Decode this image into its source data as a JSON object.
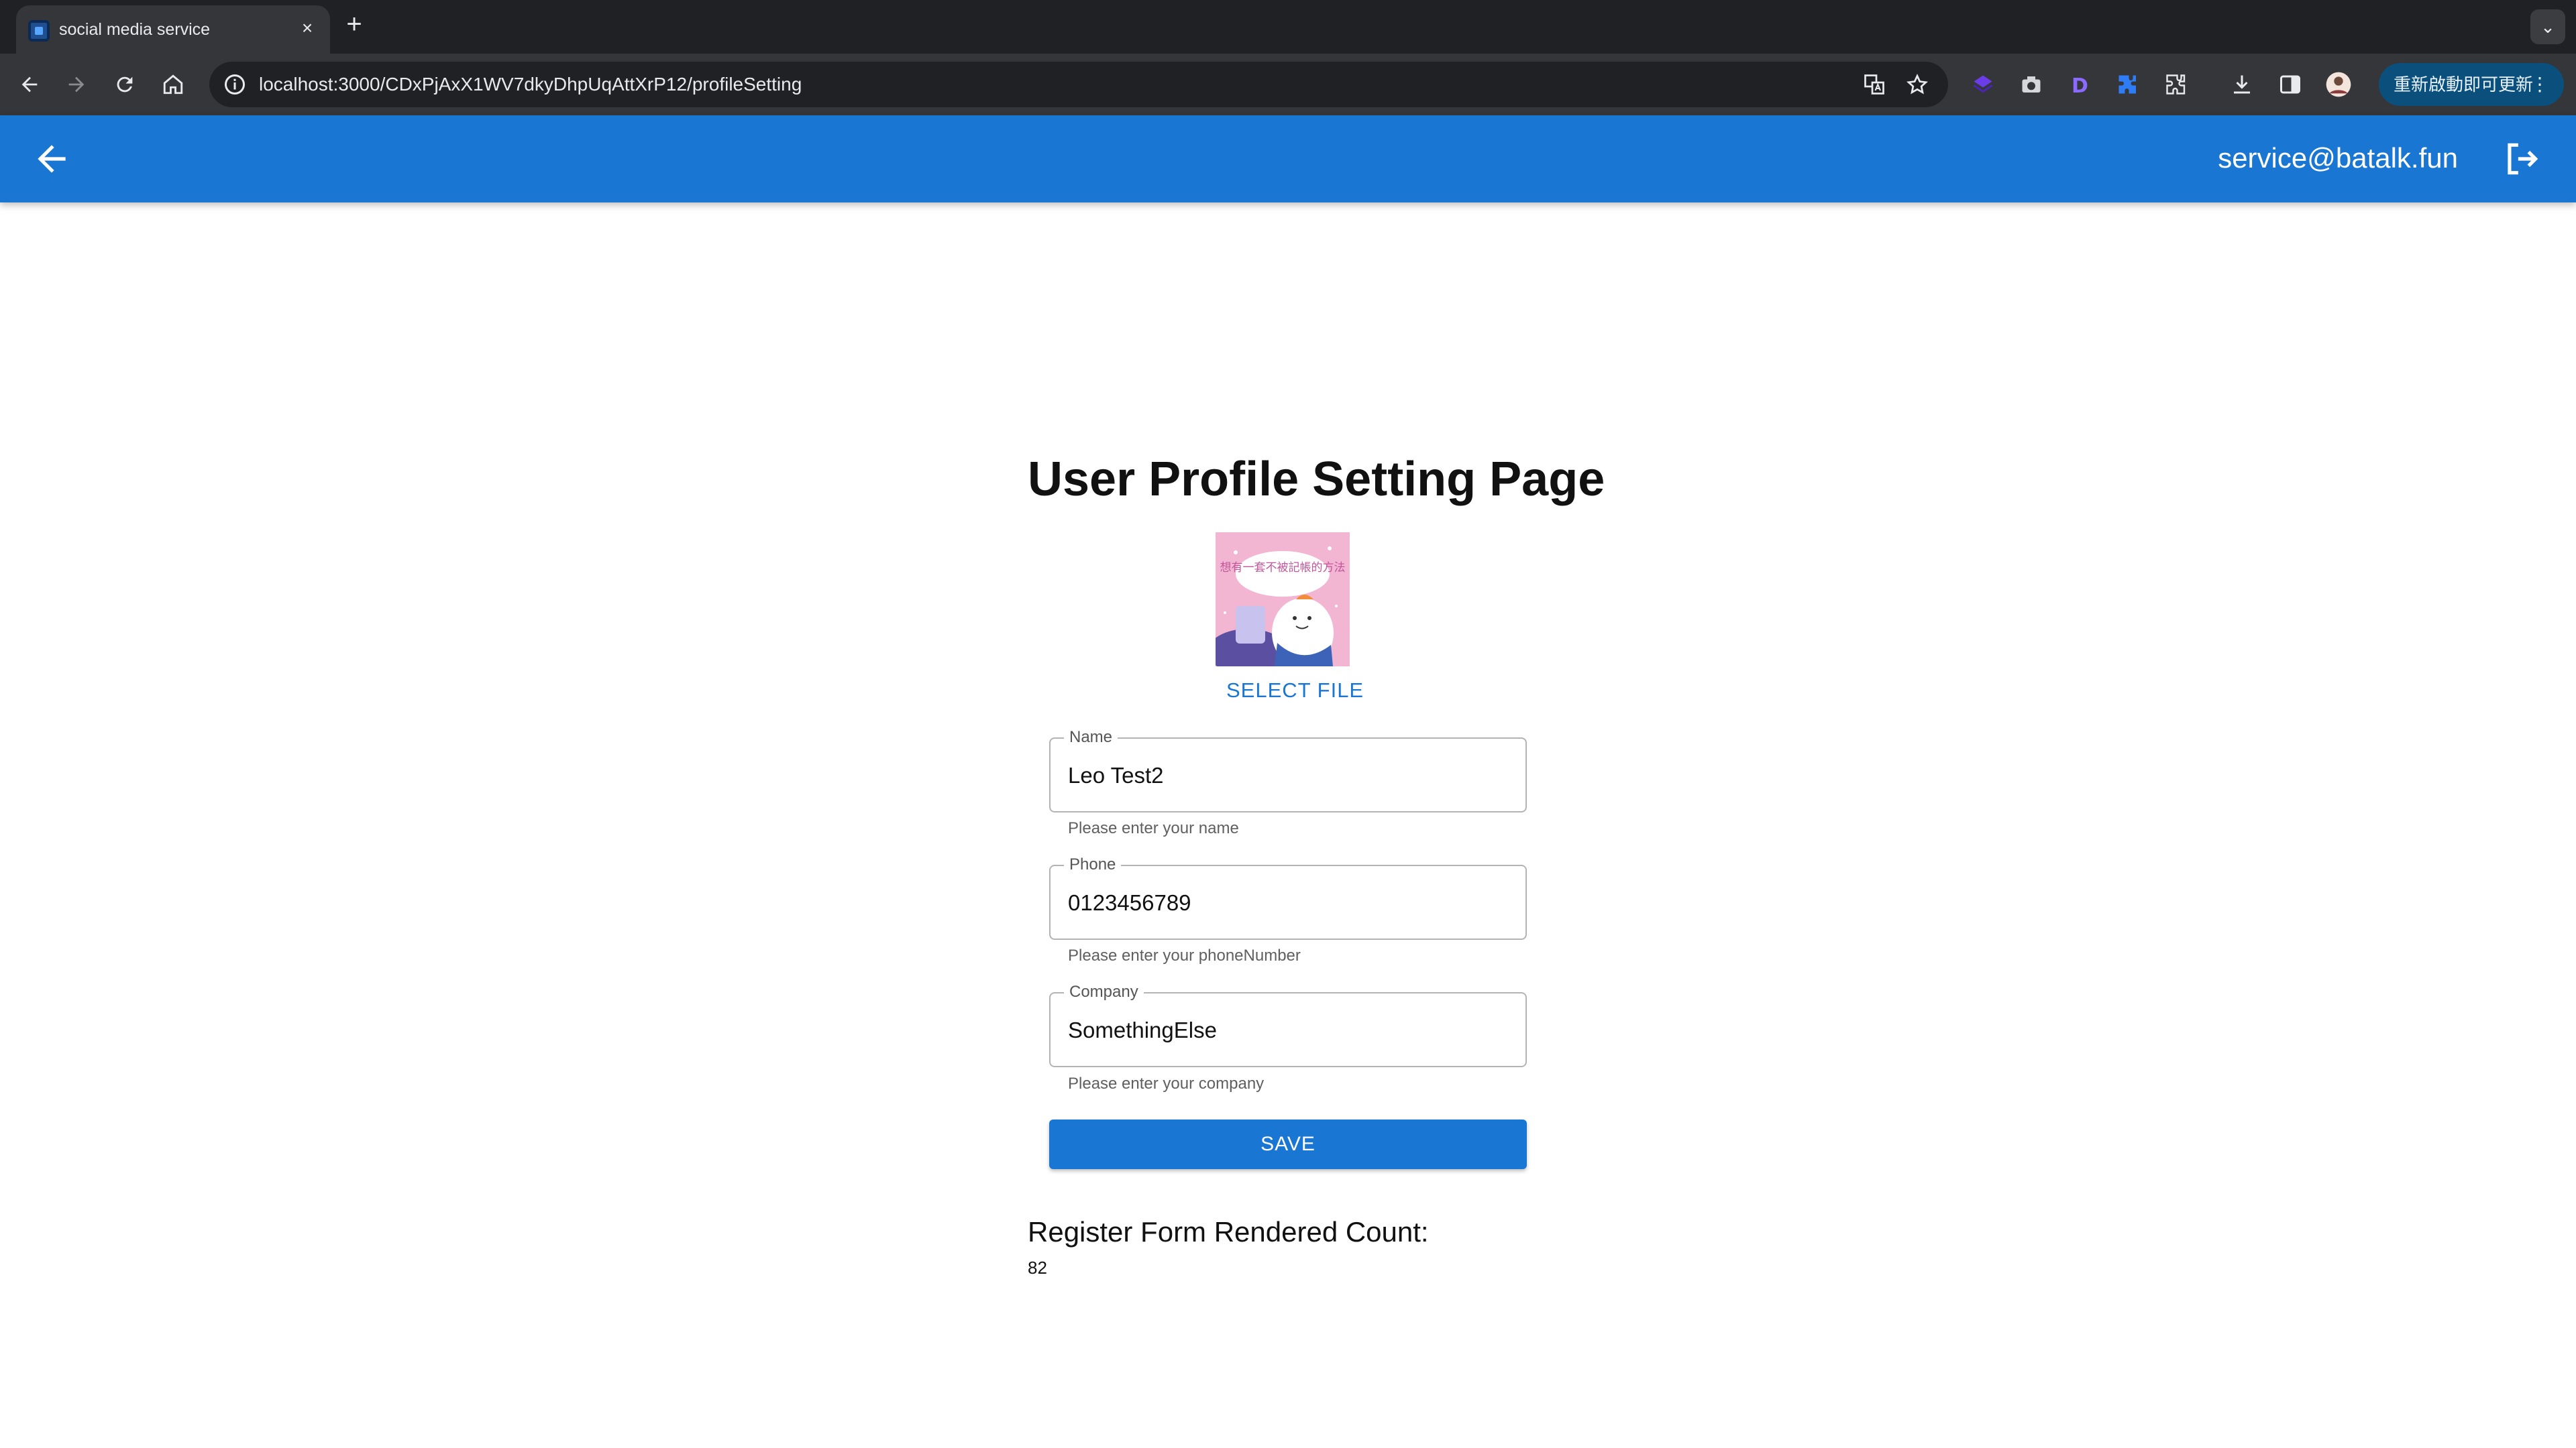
{
  "browser": {
    "tab_title": "social media service",
    "tab_close": "×",
    "new_tab": "+",
    "url": "localhost:3000/CDxPjAxX1WV7dkyDhpUqAttXrP12/profileSetting",
    "update_button": "重新啟動即可更新",
    "update_menu": "⋮",
    "tab_menu": "⌄"
  },
  "appbar": {
    "email": "service@batalk.fun"
  },
  "page": {
    "title": "User Profile Setting Page",
    "select_file": "SELECT FILE",
    "avatar_caption": "想有一套不被記帳的方法"
  },
  "form": {
    "name": {
      "label": "Name",
      "value": "Leo Test2",
      "helper": "Please enter your name"
    },
    "phone": {
      "label": "Phone",
      "value": "0123456789",
      "helper": "Please enter your phoneNumber"
    },
    "company": {
      "label": "Company",
      "value": "SomethingElse",
      "helper": "Please enter your company"
    },
    "save_label": "SAVE"
  },
  "render_count": {
    "label": "Register Form Rendered Count:",
    "value": "82"
  },
  "colors": {
    "appbar": "#1976d2",
    "primary": "#1976d2",
    "chrome_dark": "#202124",
    "chrome_toolbar": "#35363a"
  }
}
